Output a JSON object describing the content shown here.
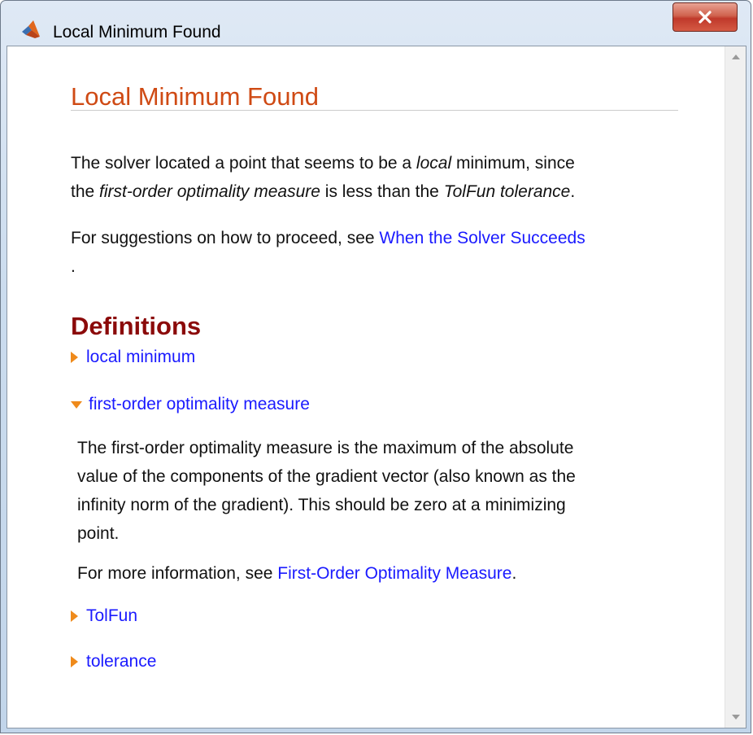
{
  "window": {
    "title": "Local Minimum Found",
    "close_label": "x"
  },
  "main": {
    "title": "Local Minimum Found",
    "para1": {
      "l1_a": "The solver located a point that seems to be a ",
      "l1_b": "local",
      "l1_c": " minimum, since",
      "l2_a": "the ",
      "l2_b": "first-order optimality measure",
      "l2_c": " is less than the ",
      "l2_d": "TolFun tolerance",
      "l2_e": "."
    },
    "para2": {
      "text": "For suggestions on how to proceed, see ",
      "link": "When the Solver Succeeds",
      "tail": "."
    },
    "definitions": {
      "heading": "Definitions",
      "items": [
        {
          "label": "local minimum",
          "expanded": false
        },
        {
          "label": "first-order optimality measure",
          "expanded": true
        },
        {
          "label": "TolFun",
          "expanded": false
        },
        {
          "label": "tolerance",
          "expanded": false
        }
      ],
      "expanded_body": {
        "line1": "The first-order optimality measure is the maximum of the absolute",
        "line2": "value of the components of the gradient vector (also known as the",
        "line3": "infinity norm of the gradient). This should be zero at a minimizing",
        "line4": "point.",
        "more_text": "For more information, see ",
        "more_link": "First-Order Optimality Measure",
        "more_tail": "."
      }
    }
  },
  "colors": {
    "title_orange": "#cf4a14",
    "heading_red": "#8b0a0a",
    "link_blue": "#1a1aff",
    "triangle_orange": "#ef8a1b"
  },
  "icons": {
    "app": "matlab-icon",
    "close": "close-icon",
    "scroll_up": "scroll-up-icon",
    "scroll_down": "scroll-down-icon"
  }
}
